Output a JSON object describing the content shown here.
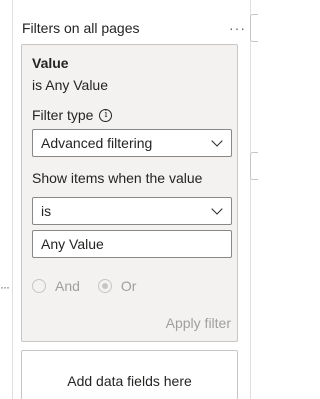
{
  "section": {
    "title": "Filters on all pages",
    "more_glyph": "···"
  },
  "left_handle_glyph": "···",
  "filter_card": {
    "field_name": "Value",
    "summary": "is Any Value",
    "filter_type_label": "Filter type",
    "info_icon_glyph": "i",
    "filter_type_value": "Advanced filtering",
    "show_items_label": "Show items when the value",
    "operator_value": "is",
    "value_input": "Any Value",
    "logic_options": [
      {
        "label": "And",
        "selected": false
      },
      {
        "label": "Or",
        "selected": true
      }
    ],
    "apply_label": "Apply filter"
  },
  "add_fields_label": "Add data fields here",
  "colors": {
    "card_background": "#f3f2f1",
    "border": "#c8c6c4",
    "disabled_text": "#a19f9d",
    "text": "#252423"
  },
  "icons": [
    "more-options-icon",
    "info-icon",
    "chevron-down-icon",
    "drag-handle-icon"
  ]
}
